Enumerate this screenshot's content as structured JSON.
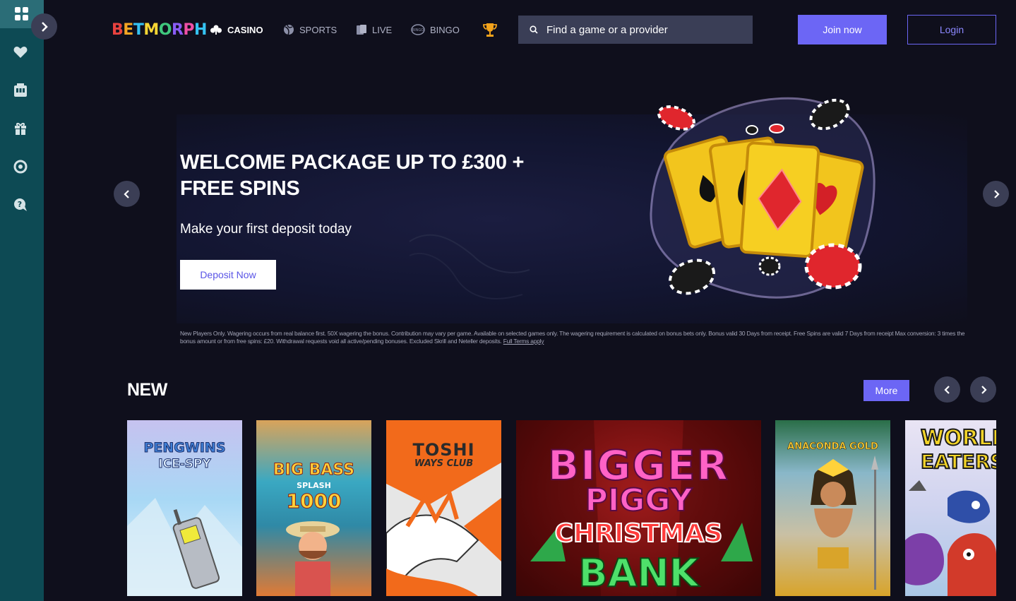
{
  "brand": {
    "logo_letters": [
      "B",
      "E",
      "T",
      "M",
      "O",
      "R",
      "P",
      "H"
    ],
    "logo_colors": [
      "#e8423f",
      "#f5a623",
      "#35c3f3",
      "#f7d634",
      "#3fc77d",
      "#8a5cf6",
      "#ef4fa6",
      "#35c3f3"
    ]
  },
  "sidebar": {
    "items": [
      {
        "name": "grid-icon"
      },
      {
        "name": "heart-icon"
      },
      {
        "name": "slot-machine-icon"
      },
      {
        "name": "gift-icon"
      },
      {
        "name": "lifebuoy-icon"
      },
      {
        "name": "chat-help-icon"
      }
    ],
    "toggle_icon": "chevron-right-icon"
  },
  "nav": {
    "casino": "CASINO",
    "sports": "SPORTS",
    "live": "LIVE",
    "bingo": "BINGO",
    "trophy_icon": "trophy-icon"
  },
  "search": {
    "placeholder": "Find a game or a provider"
  },
  "auth": {
    "join": "Join now",
    "login": "Login"
  },
  "hero": {
    "title": "WELCOME PACKAGE UP TO £300 + FREE SPINS",
    "subtitle": "Make your first deposit today",
    "cta": "Deposit Now",
    "terms": "New Players Only. Wagering occurs from real balance first. 50X wagering the bonus. Contribution may vary per game. Available on selected games only. The wagering requirement is calculated on bonus bets only. Bonus valid 30 Days from receipt. Free Spins are valid 7 Days from receipt Max conversion: 3 times the bonus amount or from free spins: £20. Withdrawal requests void all active/pending bonuses. Excluded Skrill and Neteller deposits.",
    "terms_link": "Full Terms apply"
  },
  "new_section": {
    "title": "NEW",
    "more": "More",
    "games": [
      {
        "title_line1": "PENGWINS",
        "title_line2": "ICE-SPY"
      },
      {
        "title_line1": "BIG BASS",
        "title_line2": "SPLASH",
        "title_line3": "1000"
      },
      {
        "title_line1": "TOSHI",
        "title_line2": "WAYS CLUB"
      },
      {
        "title_line1": "BIGGER",
        "title_line2": "PIGGY",
        "title_line3": "CHRISTMAS",
        "title_line4": "BANK"
      },
      {
        "title_line1": "ANACONDA GOLD"
      },
      {
        "title_line1": "WORLD",
        "title_line2": "EATERS"
      }
    ]
  },
  "colors": {
    "accent": "#6c66f5",
    "rail": "#0d4a54",
    "background": "#0f0f1c"
  }
}
